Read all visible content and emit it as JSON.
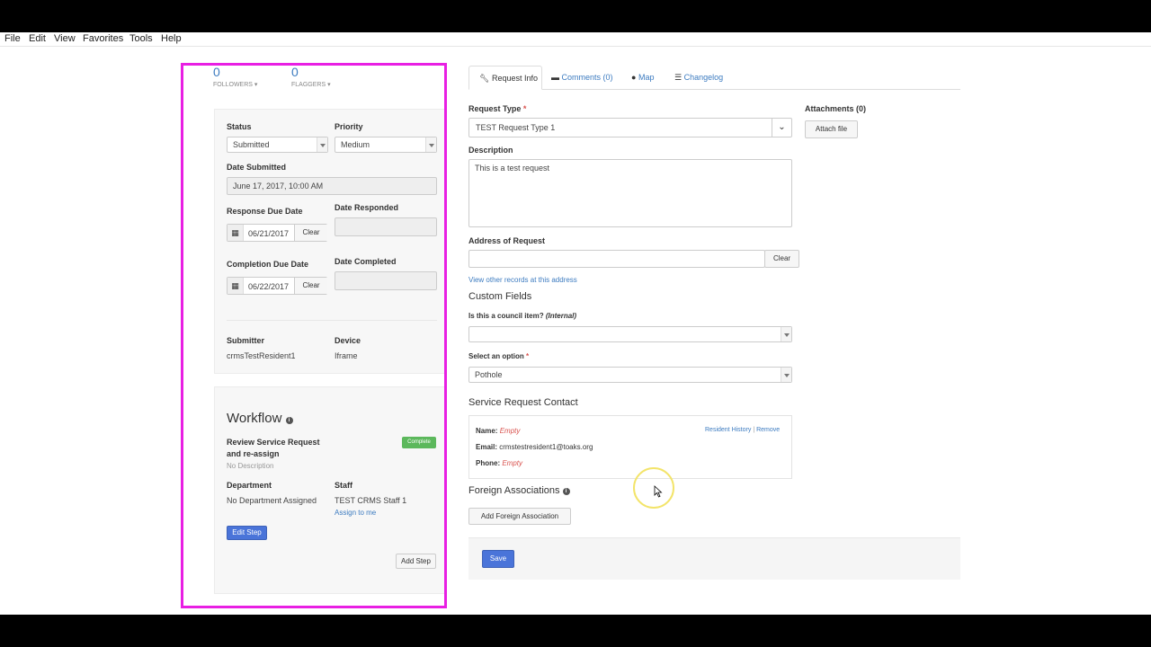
{
  "menu": [
    "File",
    "Edit",
    "View",
    "Favorites",
    "Tools",
    "Help"
  ],
  "counters": {
    "followers_count": "0",
    "followers_label": "FOLLOWERS",
    "flaggers_count": "0",
    "flaggers_label": "FLAGGERS"
  },
  "details": {
    "status_label": "Status",
    "status_value": "Submitted",
    "priority_label": "Priority",
    "priority_value": "Medium",
    "date_submitted_label": "Date Submitted",
    "date_submitted_value": "June 17, 2017, 10:00 AM",
    "response_due_label": "Response Due Date",
    "response_due_value": "06/21/2017",
    "date_responded_label": "Date Responded",
    "completion_due_label": "Completion Due Date",
    "completion_due_value": "06/22/2017",
    "date_completed_label": "Date Completed",
    "clear_label": "Clear",
    "submitter_label": "Submitter",
    "submitter_value": "crmsTestResident1",
    "device_label": "Device",
    "device_value": "Iframe"
  },
  "workflow": {
    "title": "Workflow",
    "step_title": "Review Service Request and re-assign",
    "step_badge": "Complete",
    "step_description": "No Description",
    "department_label": "Department",
    "department_value": "No Department Assigned",
    "staff_label": "Staff",
    "staff_value": "TEST CRMS Staff 1",
    "assign_link": "Assign to me",
    "edit_step": "Edit Step",
    "add_step": "Add Step"
  },
  "tabs": [
    "Request Info",
    "Comments (0)",
    "Map",
    "Changelog"
  ],
  "form": {
    "request_type_label": "Request Type",
    "required_mark": "*",
    "request_type_value": "TEST Request Type 1",
    "description_label": "Description",
    "description_value": "This is a test request",
    "address_label": "Address of Request",
    "address_value": "",
    "address_clear": "Clear",
    "view_records_link": "View other records at this address",
    "custom_fields_title": "Custom Fields",
    "council_label": "Is this a council item?",
    "council_internal": "(Internal)",
    "council_value": "",
    "option_label": "Select an option",
    "option_value": "Pothole",
    "contact_title": "Service Request Contact",
    "name_label": "Name:",
    "name_value": "Empty",
    "email_label": "Email:",
    "email_value": "crmstestresident1@toaks.org",
    "phone_label": "Phone:",
    "phone_value": "Empty",
    "resident_history_link": "Resident History",
    "separator": "|",
    "remove_link": "Remove",
    "foreign_title": "Foreign Associations",
    "add_foreign_button": "Add Foreign Association",
    "save_button": "Save"
  },
  "attachments": {
    "label": "Attachments (0)",
    "attach_button": "Attach file"
  },
  "colors": {
    "highlight_border": "#e81fe3",
    "primary": "#4a74d9",
    "badge": "#5cb85c",
    "link": "#3c7bc0",
    "required": "#d9534f"
  }
}
